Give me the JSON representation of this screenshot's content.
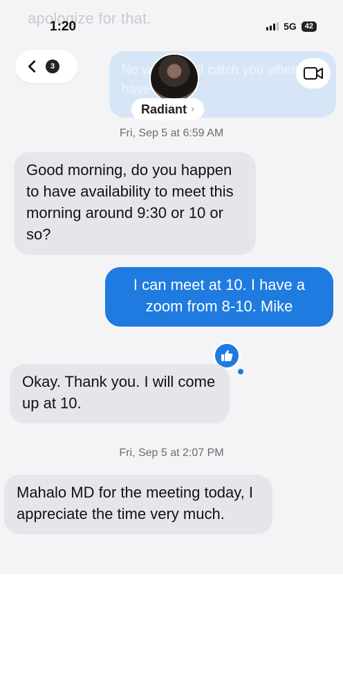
{
  "status_bar": {
    "time": "1:20",
    "network": "5G",
    "battery": "42"
  },
  "ghost": {
    "top_text": "apologize for that.",
    "bubble_text": "No worries, I'll catch you when you have time."
  },
  "nav": {
    "unread_count": "3",
    "contact_name": "Radiant",
    "contact_chevron": "›"
  },
  "messages": [
    {
      "timestamp": "Fri, Sep 5 at 6:59 AM"
    },
    {
      "direction": "incoming",
      "text": "Good morning, do you happen to have availability to meet this morning around 9:30 or 10 or so?"
    },
    {
      "direction": "outgoing",
      "text": "I can meet at 10.  I have a zoom from 8-10.  Mike"
    },
    {
      "direction": "incoming",
      "text": "Okay.  Thank you.  I will come up at 10."
    },
    {
      "timestamp": "Fri, Sep 5 at 2:07 PM"
    },
    {
      "direction": "incoming",
      "text": "Mahalo MD for the meeting today, I appreciate the time very much."
    }
  ],
  "icons": {
    "back": "chevron-left-icon",
    "video": "video-camera-icon",
    "reaction": "thumbs-up-icon"
  },
  "colors": {
    "outgoing": "#1f7be0",
    "incoming": "#e6e6ea"
  }
}
